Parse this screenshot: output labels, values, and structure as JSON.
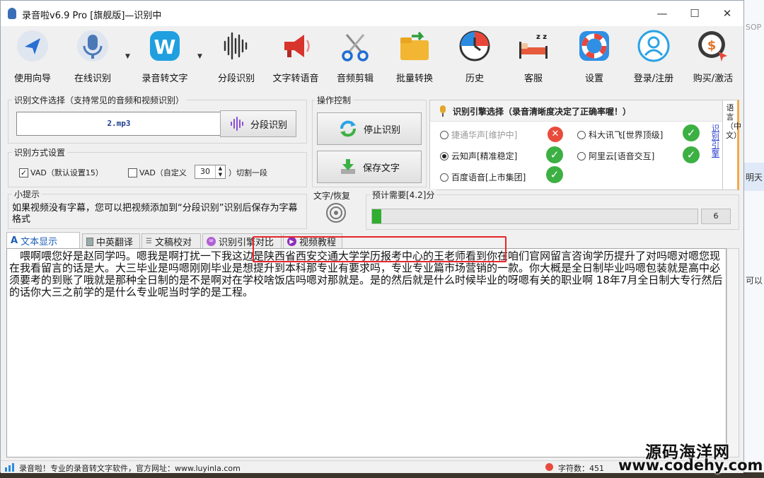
{
  "window": {
    "title": "录音啦v6.9 Pro [旗舰版]—识别中",
    "minimize_glyph": "—",
    "maximize_glyph": "☐",
    "close_glyph": "✕"
  },
  "toolbar": [
    {
      "label": "使用向导",
      "icon": "navigation-arrow-icon"
    },
    {
      "label": "在线识别",
      "icon": "microphone-icon",
      "dropdown": true
    },
    {
      "label": "录音转文字",
      "icon": "w-logo-icon",
      "dropdown": true
    },
    {
      "label": "分段识别",
      "icon": "waveform-icon"
    },
    {
      "label": "文字转语音",
      "icon": "megaphone-icon"
    },
    {
      "label": "音频剪辑",
      "icon": "scissors-icon"
    },
    {
      "label": "批量转换",
      "icon": "folder-convert-icon"
    },
    {
      "label": "历史",
      "icon": "history-clock-icon"
    },
    {
      "label": "客服",
      "icon": "bed-icon"
    },
    {
      "label": "设置",
      "icon": "lifebuoy-icon"
    },
    {
      "label": "登录/注册",
      "icon": "user-icon"
    },
    {
      "label": "购买/激活",
      "icon": "dollar-cursor-icon"
    }
  ],
  "file_section": {
    "title": "识别文件选择（支持常见的音频和视频识别）",
    "file_value": "2.mp3",
    "segment_button": "分段识别"
  },
  "mode_section": {
    "title": "识别方式设置",
    "vad_default": "VAD（默认设置15）",
    "vad_default_checked": "✓",
    "vad_custom": "VAD（自定义",
    "custom_value": "30",
    "custom_suffix": "）切割一段"
  },
  "tips_section": {
    "title": "小提示",
    "text": "如果视频没有字幕，您可以把视频添加到“分段识别”识别后保存为字幕格式"
  },
  "control_section": {
    "title": "操作控制",
    "stop_button": "停止识别",
    "save_button": "保存文字",
    "text_restore": "文字/恢复"
  },
  "progress": {
    "label": "预计需要[4.2]分",
    "fraction": 0.028,
    "counter": "6"
  },
  "engine": {
    "title": "识别引擎选择（录音清晰度决定了正确率喔！）",
    "options": [
      {
        "label": "捷通华声[维护中]",
        "status": "error",
        "selected": false,
        "disabled": true
      },
      {
        "label": "科大讯飞[世界顶级]",
        "status": "ok",
        "selected": false,
        "disabled": false
      },
      {
        "label": "云知声[精准稳定]",
        "status": "ok",
        "selected": true,
        "disabled": false
      },
      {
        "label": "阿里云[语音交互]",
        "status": "ok",
        "selected": false,
        "disabled": false
      },
      {
        "label": "百度语音[上市集团]",
        "status": "ok",
        "selected": false,
        "disabled": false
      }
    ],
    "ok_glyph": "✓",
    "error_glyph": "✕",
    "side_link": "识别引擎",
    "side_lang": "语言（中文）"
  },
  "tabs": [
    {
      "label": "文本显示",
      "active": true
    },
    {
      "label": "中英翻译",
      "active": false
    },
    {
      "label": "文稿校对",
      "active": false
    },
    {
      "label": "识别引擎对比",
      "active": false
    },
    {
      "label": "视频教程",
      "active": false
    }
  ],
  "transcript": "　喂啊喂您好是赵同学吗。嗯我是啊打扰一下我这边是陕西省西安交通大学学历报考中心的王老师看到你在咱们官网留言咨询学历提升了对吗嗯对嗯您现在我看留言的话是大。大三毕业是吗嗯刚刚毕业是想提升到本科那专业有要求吗，专业专业篇市场营销的一款。你大概是全日制毕业吗嗯包装就是高中必须要考的到账了哦就是那种全日制的是不是啊对在学校啥饭店吗嗯对那就是。是的然后就是什么时候毕业的呀嗯有关的职业啊 18年7月全日制大专行然后的话你大三之前学的是什么专业呢当时学的是工程。",
  "statusbar": {
    "left": "录音啦！专业的录音转文字软件，官方网址：www.luyinla.com",
    "right": "字符数：451"
  },
  "background": {
    "frag_top": "SOP",
    "frag_mid": "明天",
    "frag_low": "可以"
  },
  "watermark": {
    "line1": "源码海洋网",
    "line2": "www.codehy.com"
  },
  "colors": {
    "accent_blue": "#1c5fb8",
    "ok_green": "#3cb043",
    "error_red": "#e84b3c",
    "highlight_red": "#e5262a",
    "progress_green": "#2fae2f"
  }
}
